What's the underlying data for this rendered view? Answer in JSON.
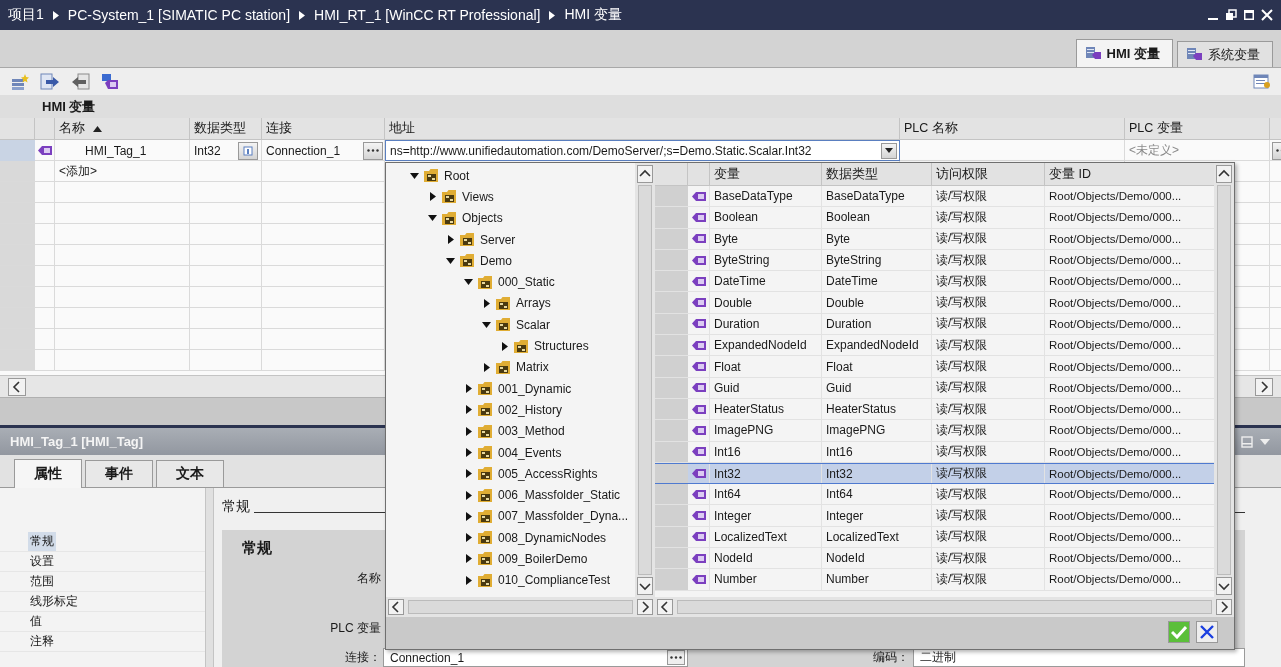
{
  "window": {
    "breadcrumb": [
      "项目1",
      "PC-System_1 [SIMATIC PC station]",
      "HMI_RT_1 [WinCC RT Professional]",
      "HMI 变量"
    ]
  },
  "editor_tabs": [
    {
      "label": "HMI 变量",
      "selected": true
    },
    {
      "label": "系统变量",
      "selected": false
    }
  ],
  "section_title": "HMI 变量",
  "table": {
    "columns": [
      {
        "label": "名称",
        "sorted": true
      },
      {
        "label": "数据类型",
        "sorted": false
      },
      {
        "label": "连接",
        "sorted": false
      },
      {
        "label": "地址",
        "sorted": false
      },
      {
        "label": "PLC 名称",
        "sorted": false
      },
      {
        "label": "PLC 变量",
        "sorted": false
      }
    ],
    "rows": [
      {
        "name": "HMI_Tag_1",
        "data_type": "Int32",
        "connection": "Connection_1",
        "address": "ns=http://www.unifiedautomation.com/DemoServer/;s=Demo.Static.Scalar.Int32",
        "plc_tag": "<未定义>",
        "selected": true
      }
    ],
    "add_row": "<添加>"
  },
  "browse": {
    "tree": [
      {
        "label": "Root",
        "expanded": true,
        "children": [
          {
            "label": "Views",
            "expanded": false
          },
          {
            "label": "Objects",
            "expanded": true,
            "children": [
              {
                "label": "Server",
                "expanded": false
              },
              {
                "label": "Demo",
                "expanded": true,
                "children": [
                  {
                    "label": "000_Static",
                    "expanded": true,
                    "children": [
                      {
                        "label": "Arrays",
                        "expanded": false
                      },
                      {
                        "label": "Scalar",
                        "expanded": true,
                        "children": [
                          {
                            "label": "Structures",
                            "expanded": false
                          }
                        ]
                      },
                      {
                        "label": "Matrix",
                        "expanded": false
                      }
                    ]
                  },
                  {
                    "label": "001_Dynamic",
                    "expanded": false
                  },
                  {
                    "label": "002_History",
                    "expanded": false
                  },
                  {
                    "label": "003_Method",
                    "expanded": false
                  },
                  {
                    "label": "004_Events",
                    "expanded": false
                  },
                  {
                    "label": "005_AccessRights",
                    "expanded": false
                  },
                  {
                    "label": "006_Massfolder_Static",
                    "expanded": false
                  },
                  {
                    "label": "007_Massfolder_Dyna...",
                    "expanded": false
                  },
                  {
                    "label": "008_DynamicNodes",
                    "expanded": false
                  },
                  {
                    "label": "009_BoilerDemo",
                    "expanded": false
                  },
                  {
                    "label": "010_ComplianceTest",
                    "expanded": false
                  }
                ]
              }
            ]
          }
        ]
      }
    ],
    "columns": [
      "变量",
      "数据类型",
      "访问权限",
      "变量 ID"
    ],
    "rows": [
      {
        "name": "BaseDataType",
        "data_type": "BaseDataType",
        "access": "读/写权限",
        "id": "Root/Objects/Demo/000...",
        "selected": false
      },
      {
        "name": "Boolean",
        "data_type": "Boolean",
        "access": "读/写权限",
        "id": "Root/Objects/Demo/000...",
        "selected": false
      },
      {
        "name": "Byte",
        "data_type": "Byte",
        "access": "读/写权限",
        "id": "Root/Objects/Demo/000...",
        "selected": false
      },
      {
        "name": "ByteString",
        "data_type": "ByteString",
        "access": "读/写权限",
        "id": "Root/Objects/Demo/000...",
        "selected": false
      },
      {
        "name": "DateTime",
        "data_type": "DateTime",
        "access": "读/写权限",
        "id": "Root/Objects/Demo/000...",
        "selected": false
      },
      {
        "name": "Double",
        "data_type": "Double",
        "access": "读/写权限",
        "id": "Root/Objects/Demo/000...",
        "selected": false
      },
      {
        "name": "Duration",
        "data_type": "Duration",
        "access": "读/写权限",
        "id": "Root/Objects/Demo/000...",
        "selected": false
      },
      {
        "name": "ExpandedNodeId",
        "data_type": "ExpandedNodeId",
        "access": "读/写权限",
        "id": "Root/Objects/Demo/000...",
        "selected": false
      },
      {
        "name": "Float",
        "data_type": "Float",
        "access": "读/写权限",
        "id": "Root/Objects/Demo/000...",
        "selected": false
      },
      {
        "name": "Guid",
        "data_type": "Guid",
        "access": "读/写权限",
        "id": "Root/Objects/Demo/000...",
        "selected": false
      },
      {
        "name": "HeaterStatus",
        "data_type": "HeaterStatus",
        "access": "读/写权限",
        "id": "Root/Objects/Demo/000...",
        "selected": false
      },
      {
        "name": "ImagePNG",
        "data_type": "ImagePNG",
        "access": "读/写权限",
        "id": "Root/Objects/Demo/000...",
        "selected": false
      },
      {
        "name": "Int16",
        "data_type": "Int16",
        "access": "读/写权限",
        "id": "Root/Objects/Demo/000...",
        "selected": false
      },
      {
        "name": "Int32",
        "data_type": "Int32",
        "access": "读/写权限",
        "id": "Root/Objects/Demo/000...",
        "selected": true
      },
      {
        "name": "Int64",
        "data_type": "Int64",
        "access": "读/写权限",
        "id": "Root/Objects/Demo/000...",
        "selected": false
      },
      {
        "name": "Integer",
        "data_type": "Integer",
        "access": "读/写权限",
        "id": "Root/Objects/Demo/000...",
        "selected": false
      },
      {
        "name": "LocalizedText",
        "data_type": "LocalizedText",
        "access": "读/写权限",
        "id": "Root/Objects/Demo/000...",
        "selected": false
      },
      {
        "name": "NodeId",
        "data_type": "NodeId",
        "access": "读/写权限",
        "id": "Root/Objects/Demo/000...",
        "selected": false
      },
      {
        "name": "Number",
        "data_type": "Number",
        "access": "读/写权限",
        "id": "Root/Objects/Demo/000...",
        "selected": false
      }
    ]
  },
  "props": {
    "title": "HMI_Tag_1 [HMI_Tag]",
    "tabs": [
      {
        "label": "属性",
        "selected": true
      },
      {
        "label": "事件",
        "selected": false
      },
      {
        "label": "文本",
        "selected": false
      }
    ],
    "nav": [
      {
        "label": "常规",
        "selected": true
      },
      {
        "label": "设置",
        "selected": false
      },
      {
        "label": "范围",
        "selected": false
      },
      {
        "label": "线形标定",
        "selected": false
      },
      {
        "label": "值",
        "selected": false
      },
      {
        "label": "注释",
        "selected": false
      }
    ],
    "section": "常规",
    "group_title": "常规",
    "labels": [
      "名称",
      "PLC 变量"
    ],
    "connection": {
      "label": "连接：",
      "value": "Connection_1"
    },
    "encoding": {
      "label": "编码：",
      "value": "二进制"
    }
  }
}
